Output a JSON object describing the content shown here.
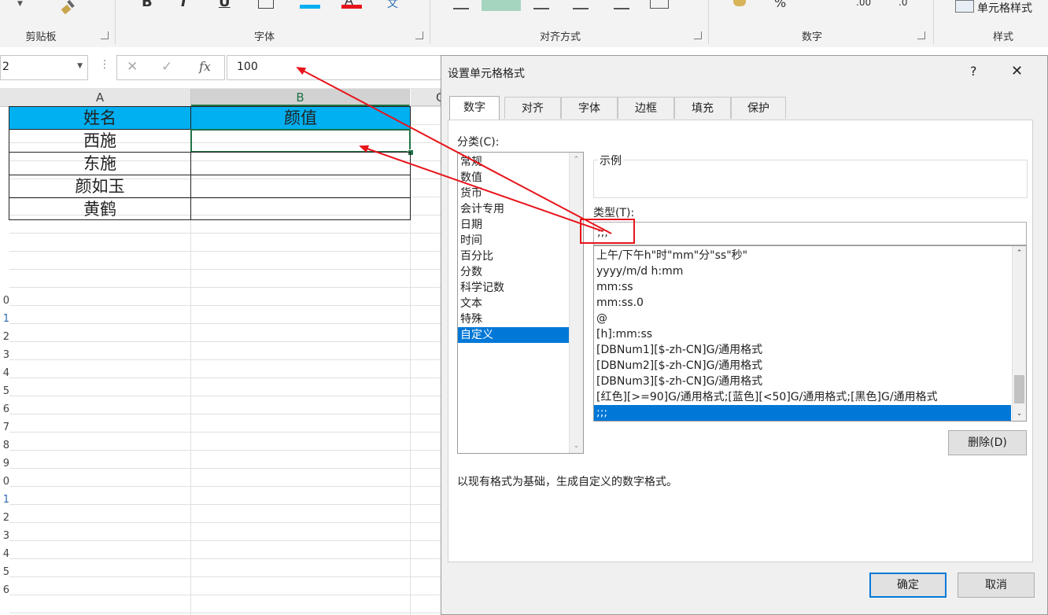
{
  "ribbon": {
    "groups": {
      "clipboard": "剪贴板",
      "font": "字体",
      "alignment": "对齐方式",
      "number": "数字",
      "styles": "样式"
    },
    "cell_styles_label": "单元格样式",
    "number_glyph_pct": "%",
    "number_glyph_dec_inc": ".00",
    "number_glyph_dec_dec": ".0",
    "font_glyphs": [
      "B",
      "I",
      "U",
      "文"
    ]
  },
  "formula_bar": {
    "name_box": "2",
    "cancel_icon": "✕",
    "enter_icon": "✓",
    "fx_label": "fx",
    "value": "100"
  },
  "sheet": {
    "col_headers": [
      "A",
      "B",
      "C"
    ],
    "table": {
      "header": [
        "姓名",
        "颜值"
      ],
      "rows": [
        [
          "西施",
          ""
        ],
        [
          "东施",
          ""
        ],
        [
          "颜如玉",
          ""
        ],
        [
          "黄鹤",
          ""
        ]
      ]
    },
    "row_numbers_partial": [
      "0",
      "1",
      "2",
      "3",
      "4",
      "5",
      "6",
      "7",
      "8",
      "9",
      "0",
      "1",
      "2",
      "3",
      "4",
      "5",
      "6"
    ]
  },
  "dialog": {
    "title": "设置单元格格式",
    "help": "?",
    "close": "✕",
    "tabs": [
      "数字",
      "对齐",
      "字体",
      "边框",
      "填充",
      "保护"
    ],
    "active_tab": "数字",
    "category_label": "分类(C):",
    "categories": [
      "常规",
      "数值",
      "货币",
      "会计专用",
      "日期",
      "时间",
      "百分比",
      "分数",
      "科学记数",
      "文本",
      "特殊",
      "自定义"
    ],
    "selected_category": "自定义",
    "sample_label": "示例",
    "type_label": "类型(T):",
    "type_value": ";;;",
    "formats": [
      "上午/下午h\"时\"mm\"分\"ss\"秒\"",
      "yyyy/m/d h:mm",
      "mm:ss",
      "mm:ss.0",
      "@",
      "[h]:mm:ss",
      "[DBNum1][$-zh-CN]G/通用格式",
      "[DBNum2][$-zh-CN]G/通用格式",
      "[DBNum3][$-zh-CN]G/通用格式",
      "[红色][>=90]G/通用格式;[蓝色][<50]G/通用格式;[黑色]G/通用格式",
      ";;;"
    ],
    "selected_format": ";;;",
    "delete_button": "删除(D)",
    "description": "以现有格式为基础，生成自定义的数字格式。",
    "ok_button": "确定",
    "cancel_button": "取消"
  },
  "colors": {
    "header_fill": "#00b0f0",
    "selection_blue": "#0078d7",
    "annotation_red": "#e8141b",
    "active_cell_green": "#217346"
  }
}
